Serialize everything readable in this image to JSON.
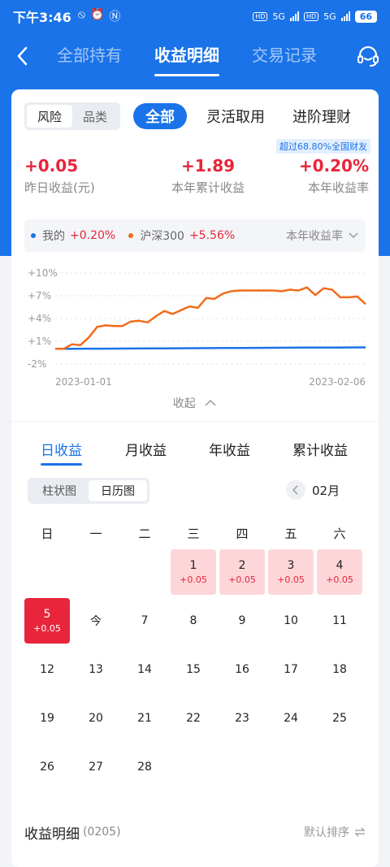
{
  "status": {
    "time": "下午3:46",
    "net1": "5G",
    "hd1": "HD",
    "net2": "5G",
    "hd2": "HD",
    "battery": "66"
  },
  "nav": {
    "tabs": [
      {
        "label": "全部持有"
      },
      {
        "label": "收益明细"
      },
      {
        "label": "交易记录"
      }
    ],
    "active_tab": 1
  },
  "filter": {
    "risk": "风险",
    "category": "品类",
    "all": "全部",
    "flex": "灵活取用",
    "advanced": "进阶理财"
  },
  "beat_badge": "超过68.80%全国财友",
  "stats": [
    {
      "value": "+0.05",
      "label": "昨日收益(元)"
    },
    {
      "value": "+1.89",
      "label": "本年累计收益"
    },
    {
      "value": "+0.20%",
      "label": "本年收益率"
    }
  ],
  "legend": {
    "mine_label": "我的",
    "mine_value": "+0.20%",
    "bench_label": "沪深300",
    "bench_value": "+5.56%",
    "metric": "本年收益率"
  },
  "chart_data": {
    "type": "line",
    "x_start": "2023-01-01",
    "x_end": "2023-02-06",
    "y_ticks": [
      "+10%",
      "+7%",
      "+4%",
      "+1%",
      "-2%"
    ],
    "ylim": [
      -2,
      10
    ],
    "series": [
      {
        "name": "我的",
        "color": "#1a73e8",
        "values": [
          0.0,
          0.01,
          0.02,
          0.03,
          0.04,
          0.05,
          0.06,
          0.07,
          0.08,
          0.09,
          0.1,
          0.11,
          0.12,
          0.13,
          0.14,
          0.15,
          0.16,
          0.17,
          0.18,
          0.19,
          0.2
        ]
      },
      {
        "name": "沪深300",
        "color": "#f26b1d",
        "values": [
          0.0,
          0.0,
          0.6,
          0.5,
          1.5,
          2.9,
          3.1,
          3.0,
          3.0,
          3.6,
          3.7,
          3.5,
          4.3,
          5.0,
          4.6,
          5.1,
          5.6,
          5.4,
          6.7,
          6.6,
          7.3,
          7.6,
          7.7,
          7.7,
          7.7,
          7.7,
          7.7,
          7.6,
          7.8,
          7.7,
          8.1,
          7.1,
          8.0,
          7.8,
          6.8,
          6.8,
          6.9,
          5.9
        ]
      }
    ]
  },
  "collapse_label": "收起",
  "period_tabs": [
    {
      "label": "日收益"
    },
    {
      "label": "月收益"
    },
    {
      "label": "年收益"
    },
    {
      "label": "累计收益"
    }
  ],
  "view": {
    "bar": "柱状图",
    "calendar": "日历图"
  },
  "month_label": "02月",
  "weekdays": [
    "日",
    "一",
    "二",
    "三",
    "四",
    "五",
    "六"
  ],
  "calendar": [
    {
      "day": "1",
      "col": 3,
      "row": 0,
      "profit": "+0.05",
      "state": "gain"
    },
    {
      "day": "2",
      "col": 4,
      "row": 0,
      "profit": "+0.05",
      "state": "gain"
    },
    {
      "day": "3",
      "col": 5,
      "row": 0,
      "profit": "+0.05",
      "state": "gain"
    },
    {
      "day": "4",
      "col": 6,
      "row": 0,
      "profit": "+0.05",
      "state": "gain"
    },
    {
      "day": "5",
      "col": 0,
      "row": 1,
      "profit": "+0.05",
      "state": "today"
    },
    {
      "day": "今",
      "col": 1,
      "row": 1,
      "state": "plain"
    },
    {
      "day": "7",
      "col": 2,
      "row": 1,
      "state": "plain"
    },
    {
      "day": "8",
      "col": 3,
      "row": 1,
      "state": "plain"
    },
    {
      "day": "9",
      "col": 4,
      "row": 1,
      "state": "plain"
    },
    {
      "day": "10",
      "col": 5,
      "row": 1,
      "state": "plain"
    },
    {
      "day": "11",
      "col": 6,
      "row": 1,
      "state": "plain"
    },
    {
      "day": "12",
      "col": 0,
      "row": 2,
      "state": "plain"
    },
    {
      "day": "13",
      "col": 1,
      "row": 2,
      "state": "plain"
    },
    {
      "day": "14",
      "col": 2,
      "row": 2,
      "state": "plain"
    },
    {
      "day": "15",
      "col": 3,
      "row": 2,
      "state": "plain"
    },
    {
      "day": "16",
      "col": 4,
      "row": 2,
      "state": "plain"
    },
    {
      "day": "17",
      "col": 5,
      "row": 2,
      "state": "plain"
    },
    {
      "day": "18",
      "col": 6,
      "row": 2,
      "state": "plain"
    },
    {
      "day": "19",
      "col": 0,
      "row": 3,
      "state": "plain"
    },
    {
      "day": "20",
      "col": 1,
      "row": 3,
      "state": "plain"
    },
    {
      "day": "21",
      "col": 2,
      "row": 3,
      "state": "plain"
    },
    {
      "day": "22",
      "col": 3,
      "row": 3,
      "state": "plain"
    },
    {
      "day": "23",
      "col": 4,
      "row": 3,
      "state": "plain"
    },
    {
      "day": "24",
      "col": 5,
      "row": 3,
      "state": "plain"
    },
    {
      "day": "25",
      "col": 6,
      "row": 3,
      "state": "plain"
    },
    {
      "day": "26",
      "col": 0,
      "row": 4,
      "state": "plain"
    },
    {
      "day": "27",
      "col": 1,
      "row": 4,
      "state": "plain"
    },
    {
      "day": "28",
      "col": 2,
      "row": 4,
      "state": "plain"
    }
  ],
  "detail": {
    "title": "收益明细",
    "code": "(0205)",
    "sort": "默认排序"
  },
  "icons": {
    "back": "back-arrow-icon",
    "service": "customer-service-icon",
    "chevron": "chevron-down-icon",
    "sort": "swap-icon"
  }
}
